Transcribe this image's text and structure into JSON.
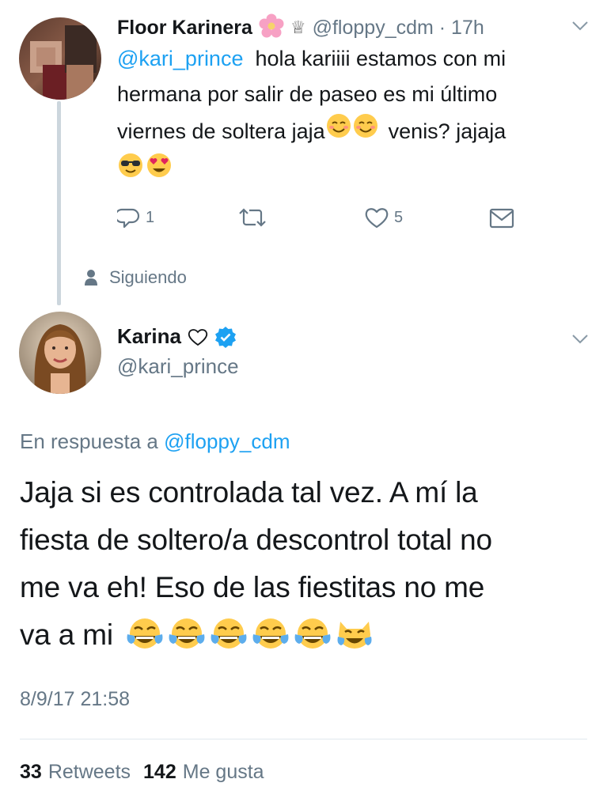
{
  "reply_tweet": {
    "display_name": "Floor Karinera",
    "handle_time": "@floppy_cdm · 17h",
    "mention": "@kari_prince",
    "text_line1": "hola kariiii estamos con mi",
    "text_line2": "hermana por salir de paseo es mi último",
    "text_line3a": "viernes de soltera jaja",
    "text_line3b": "venis? jajaja",
    "reply_count": "1",
    "like_count": "5"
  },
  "following_label": "Siguiendo",
  "main_tweet": {
    "display_name": "Karina",
    "handle": "@kari_prince",
    "reply_prefix": "En respuesta a",
    "reply_to": "@floppy_cdm",
    "text_line1": "Jaja si es controlada tal vez. A mí la",
    "text_line2": "fiesta de soltero/a descontrol total no",
    "text_line3": "me va eh! Eso de las fiestitas no me",
    "text_line4": "va a mi",
    "timestamp": "8/9/17 21:58",
    "retweets_count": "33",
    "retweets_label": "Retweets",
    "likes_count": "142",
    "likes_label": "Me gusta"
  },
  "colors": {
    "link": "#1da1f2",
    "muted": "#657786",
    "line": "#ccd6dd"
  },
  "icons": [
    "reply-icon",
    "retweet-icon",
    "like-icon",
    "dm-icon",
    "person-icon",
    "chevron-down-icon",
    "verified-badge-icon",
    "crown-icon",
    "flower-emoji",
    "heart-outline-icon",
    "smiling-emoji",
    "sunglasses-emoji",
    "heart-eyes-emoji",
    "tears-of-joy-emoji",
    "cat-tears-of-joy-emoji"
  ]
}
